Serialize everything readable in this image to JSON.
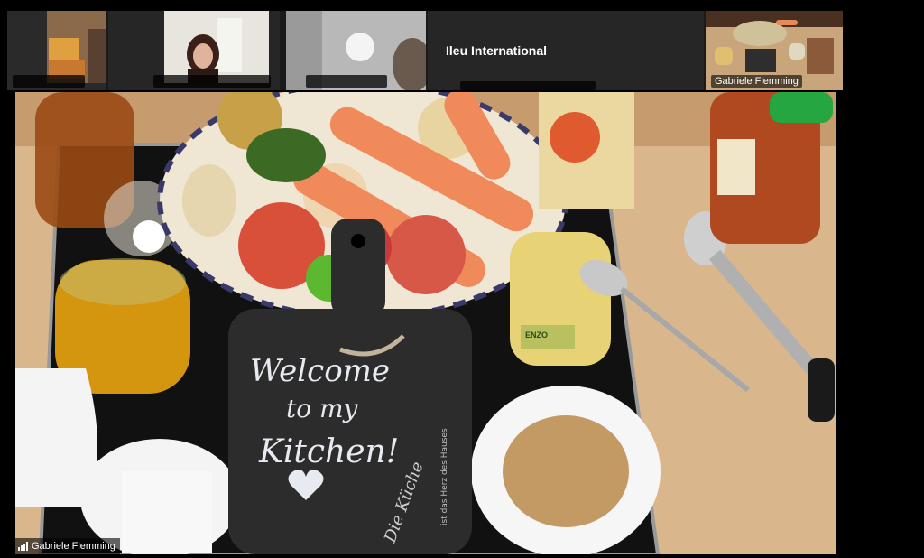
{
  "gallery": {
    "tiles": [
      {
        "id": "participant-1"
      },
      {
        "id": "participant-2"
      },
      {
        "id": "participant-3"
      },
      {
        "id": "ileu",
        "title": "Ileu International"
      },
      {
        "id": "gabriele",
        "name": "Gabriele Flemming"
      }
    ]
  },
  "main": {
    "speaker_name": "Gabriele Flemming",
    "chalkboard": {
      "line1": "Welcome",
      "line2": "to my",
      "line3": "Kitchen!",
      "brand": "Die Küche",
      "tagline": "ist das Herz des Hauses"
    },
    "jar_label": "ENZO"
  },
  "colors": {
    "background": "#000000",
    "gallery_bg": "#1a1a1a",
    "tile_bg": "#262626",
    "counter": "#d9b68c",
    "stovetop": "#101010"
  }
}
